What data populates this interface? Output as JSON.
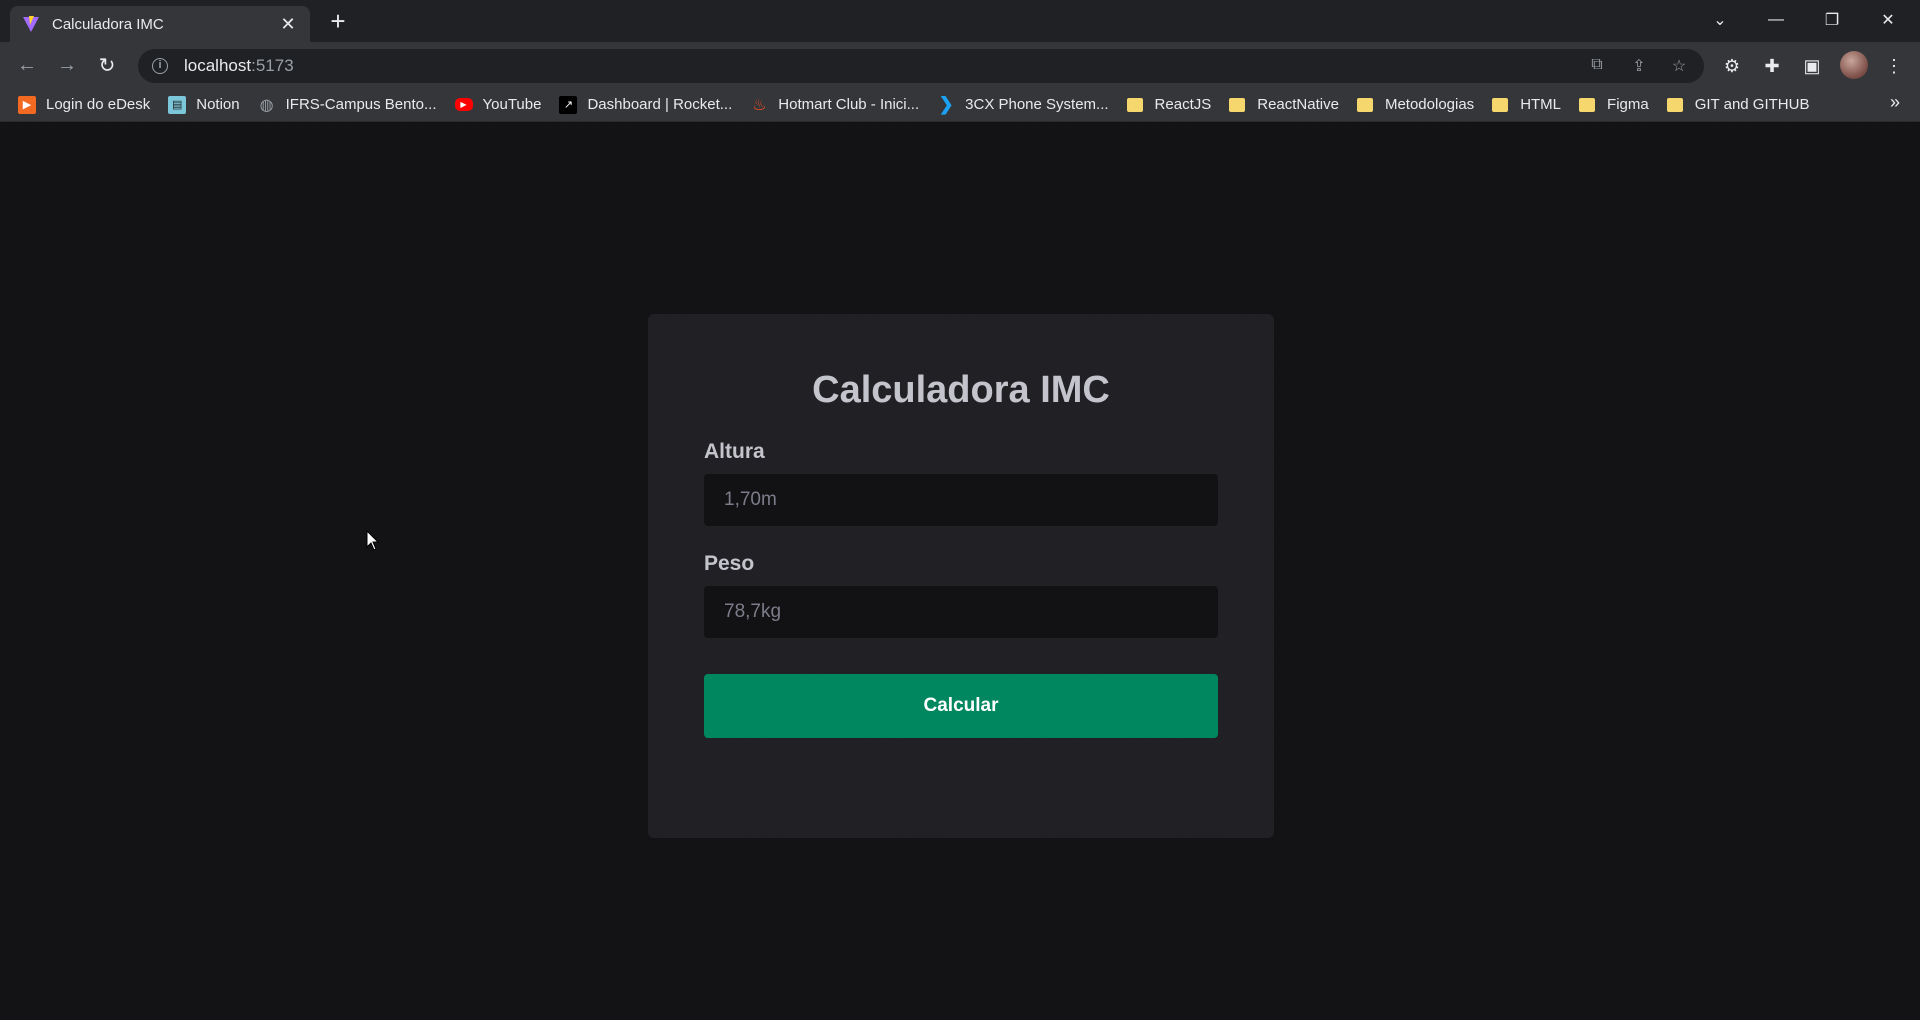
{
  "browser": {
    "tab": {
      "title": "Calculadora IMC"
    },
    "address": {
      "host": "localhost",
      "port": ":5173"
    },
    "bookmarks": [
      {
        "label": "Login do eDesk",
        "icon": "edesk-icon"
      },
      {
        "label": "Notion",
        "icon": "notion-icon"
      },
      {
        "label": "IFRS-Campus Bento...",
        "icon": "globe-icon"
      },
      {
        "label": "YouTube",
        "icon": "youtube-icon"
      },
      {
        "label": "Dashboard | Rocket...",
        "icon": "rocketseat-icon"
      },
      {
        "label": "Hotmart Club - Inici...",
        "icon": "hotmart-icon"
      },
      {
        "label": "3CX Phone System...",
        "icon": "3cx-icon"
      },
      {
        "label": "ReactJS",
        "icon": "folder-icon"
      },
      {
        "label": "ReactNative",
        "icon": "folder-icon"
      },
      {
        "label": "Metodologias",
        "icon": "folder-icon"
      },
      {
        "label": "HTML",
        "icon": "folder-icon"
      },
      {
        "label": "Figma",
        "icon": "folder-icon"
      },
      {
        "label": "GIT and GITHUB",
        "icon": "folder-icon"
      }
    ]
  },
  "page": {
    "title": "Calculadora IMC",
    "height_label": "Altura",
    "height_placeholder": "1,70m",
    "weight_label": "Peso",
    "weight_placeholder": "78,7kg",
    "button_label": "Calcular"
  },
  "colors": {
    "background": "#121214",
    "card": "#202024",
    "button": "#00875f",
    "text": "#c4c4cc"
  }
}
